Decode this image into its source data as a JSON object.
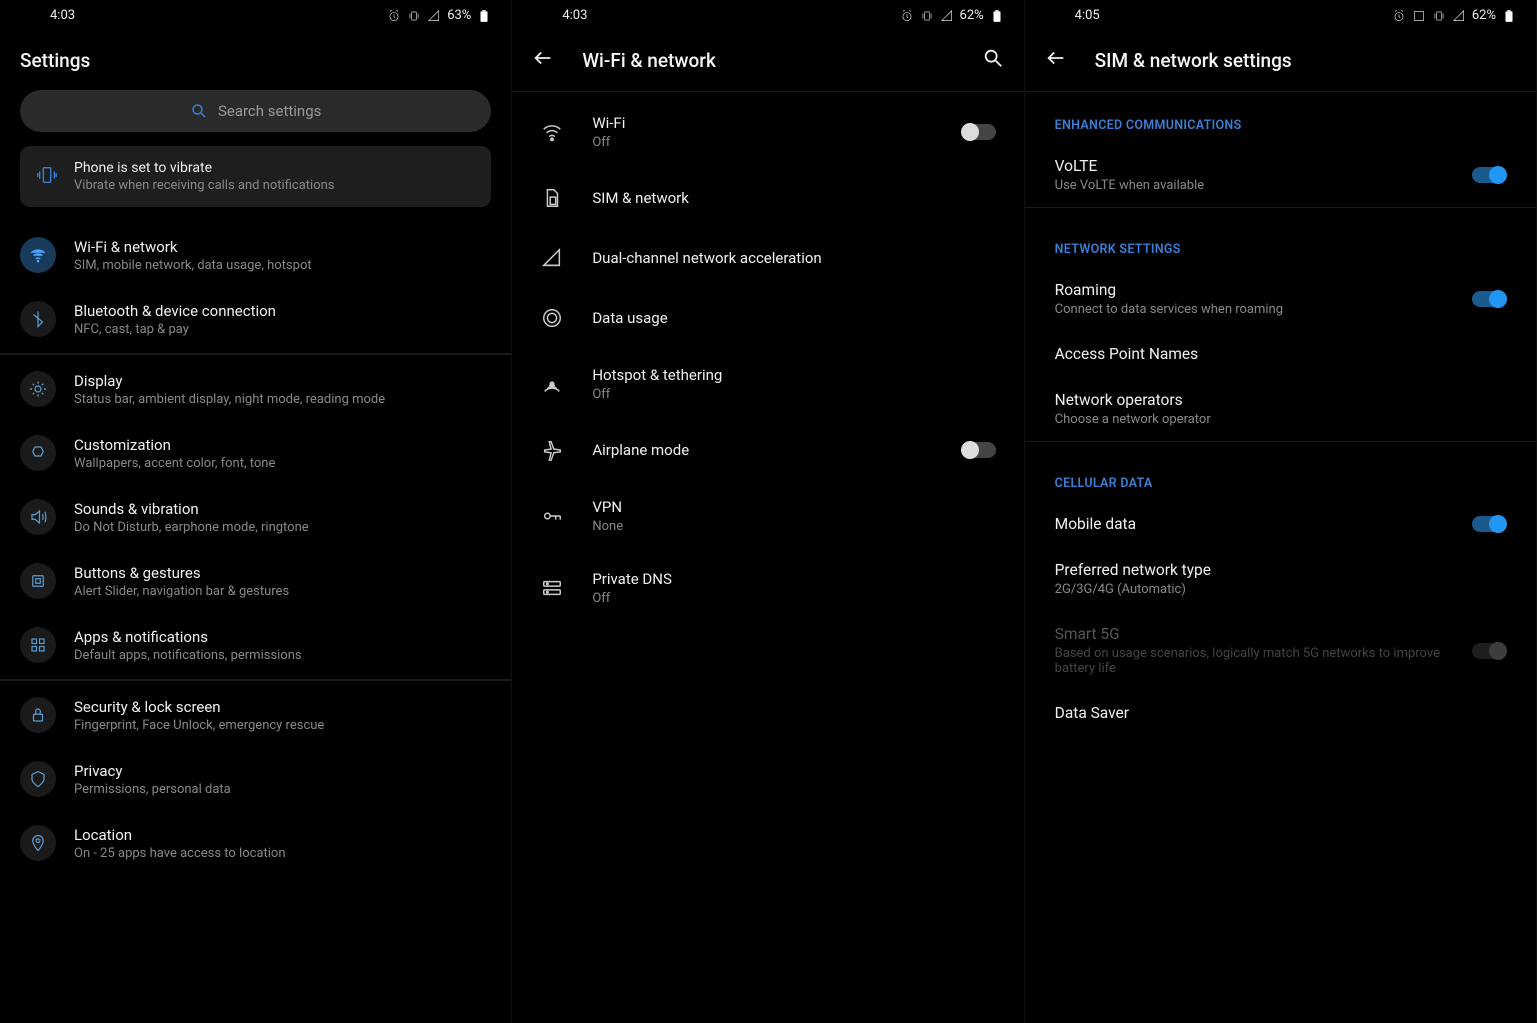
{
  "screen1": {
    "status": {
      "time": "4:03",
      "battery": "63%"
    },
    "title": "Settings",
    "search_placeholder": "Search settings",
    "notice": {
      "title": "Phone is set to vibrate",
      "sub": "Vibrate when receiving calls and notifications"
    },
    "groups": [
      [
        {
          "key": "wifi",
          "title": "Wi-Fi & network",
          "sub": "SIM, mobile network, data usage, hotspot",
          "active": true
        },
        {
          "key": "bluetooth",
          "title": "Bluetooth & device connection",
          "sub": "NFC, cast, tap & pay"
        }
      ],
      [
        {
          "key": "display",
          "title": "Display",
          "sub": "Status bar, ambient display, night mode, reading mode"
        },
        {
          "key": "customization",
          "title": "Customization",
          "sub": "Wallpapers, accent color, font, tone"
        },
        {
          "key": "sounds",
          "title": "Sounds & vibration",
          "sub": "Do Not Disturb, earphone mode, ringtone"
        },
        {
          "key": "buttons",
          "title": "Buttons & gestures",
          "sub": "Alert Slider, navigation bar & gestures"
        },
        {
          "key": "apps",
          "title": "Apps & notifications",
          "sub": "Default apps, notifications, permissions"
        }
      ],
      [
        {
          "key": "security",
          "title": "Security & lock screen",
          "sub": "Fingerprint, Face Unlock, emergency rescue"
        },
        {
          "key": "privacy",
          "title": "Privacy",
          "sub": "Permissions, personal data"
        },
        {
          "key": "location",
          "title": "Location",
          "sub": "On - 25 apps have access to location"
        }
      ]
    ]
  },
  "screen2": {
    "status": {
      "time": "4:03",
      "battery": "62%"
    },
    "title": "Wi-Fi & network",
    "items": [
      {
        "key": "wifi",
        "title": "Wi-Fi",
        "sub": "Off",
        "toggle": false
      },
      {
        "key": "sim",
        "title": "SIM & network"
      },
      {
        "key": "dual",
        "title": "Dual-channel network acceleration"
      },
      {
        "key": "data",
        "title": "Data usage"
      },
      {
        "key": "hotspot",
        "title": "Hotspot & tethering",
        "sub": "Off"
      },
      {
        "key": "airplane",
        "title": "Airplane mode",
        "toggle": false
      },
      {
        "key": "vpn",
        "title": "VPN",
        "sub": "None"
      },
      {
        "key": "dns",
        "title": "Private DNS",
        "sub": "Off"
      }
    ]
  },
  "screen3": {
    "status": {
      "time": "4:05",
      "battery": "62%"
    },
    "title": "SIM & network settings",
    "sections": [
      {
        "header": "ENHANCED COMMUNICATIONS",
        "items": [
          {
            "key": "volte",
            "title": "VoLTE",
            "sub": "Use VoLTE when available",
            "toggle": true
          }
        ]
      },
      {
        "header": "NETWORK SETTINGS",
        "items": [
          {
            "key": "roaming",
            "title": "Roaming",
            "sub": "Connect to data services when roaming",
            "toggle": true
          },
          {
            "key": "apn",
            "title": "Access Point Names"
          },
          {
            "key": "operators",
            "title": "Network operators",
            "sub": "Choose a network operator"
          }
        ]
      },
      {
        "header": "CELLULAR DATA",
        "items": [
          {
            "key": "mobiledata",
            "title": "Mobile data",
            "toggle": true
          },
          {
            "key": "prefnet",
            "title": "Preferred network type",
            "sub": "2G/3G/4G (Automatic)"
          },
          {
            "key": "smart5g",
            "title": "Smart 5G",
            "sub": "Based on usage scenarios, logically match 5G networks to improve battery life",
            "toggle": false,
            "disabled": true
          },
          {
            "key": "datasaver",
            "title": "Data Saver"
          }
        ]
      }
    ]
  }
}
